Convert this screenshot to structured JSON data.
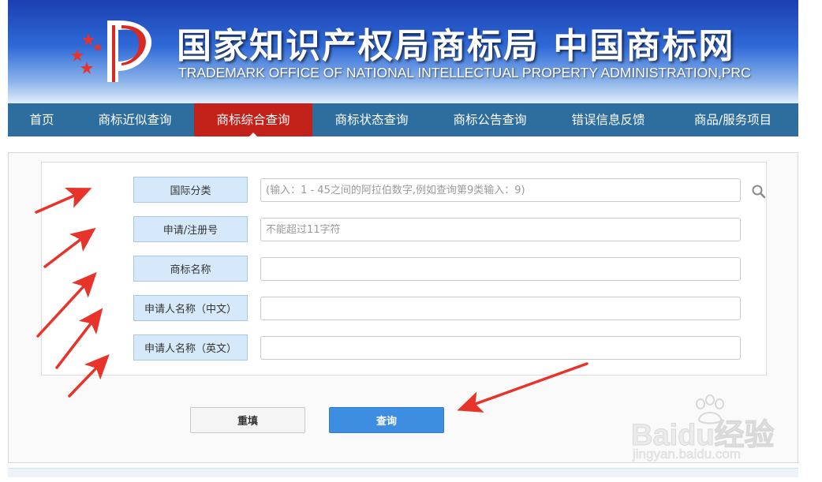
{
  "header": {
    "title_cn": "国家知识产权局商标局 中国商标网",
    "title_en": "TRADEMARK OFFICE OF NATIONAL INTELLECTUAL PROPERTY ADMINISTRATION,PRC",
    "logo_icon": "cnipa-logo-icon"
  },
  "nav": {
    "items": [
      {
        "label": "首页"
      },
      {
        "label": "商标近似查询"
      },
      {
        "label": "商标综合查询"
      },
      {
        "label": "商标状态查询"
      },
      {
        "label": "商标公告查询"
      },
      {
        "label": "错误信息反馈"
      },
      {
        "label": "商品/服务项目"
      }
    ],
    "active_index": 2,
    "bg_color": "#2d6e9f",
    "active_color": "#c3221a"
  },
  "form": {
    "fields": [
      {
        "label": "国际分类",
        "value": "",
        "placeholder": "(输入：1 - 45之间的阿拉伯数字,例如查询第9类输入：9)"
      },
      {
        "label": "申请/注册号",
        "value": "",
        "placeholder": "不能超过11字符"
      },
      {
        "label": "商标名称",
        "value": "",
        "placeholder": ""
      },
      {
        "label": "申请人名称（中文）",
        "value": "",
        "placeholder": ""
      },
      {
        "label": "申请人名称（英文）",
        "value": "",
        "placeholder": ""
      }
    ],
    "search_icon": "search-icon",
    "reset_label": "重填",
    "search_label": "查询",
    "label_bg": "#d6e9fb",
    "search_button_color": "#3d8ee0"
  },
  "annotation": {
    "arrow_color": "#e8332a"
  },
  "watermark": {
    "main": "Baidu经验",
    "sub": "jingyan.baidu.com"
  }
}
